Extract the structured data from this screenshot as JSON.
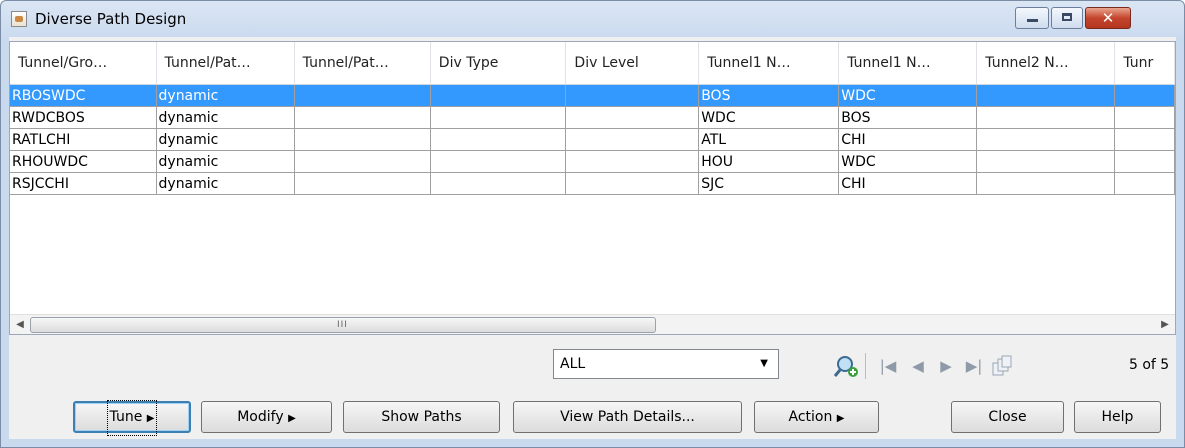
{
  "window": {
    "title": "Diverse Path Design"
  },
  "table": {
    "columns": [
      "Tunnel/Gro…",
      "Tunnel/Pat…",
      "Tunnel/Pat…",
      "Div Type",
      "Div Level",
      "Tunnel1 N…",
      "Tunnel1 N…",
      "Tunnel2 N…",
      "Tunr"
    ],
    "rows": [
      [
        "RBOSWDC",
        "dynamic",
        "",
        "",
        "",
        "BOS",
        "WDC",
        "",
        ""
      ],
      [
        "RWDCBOS",
        "dynamic",
        "",
        "",
        "",
        "WDC",
        "BOS",
        "",
        ""
      ],
      [
        "RATLCHI",
        "dynamic",
        "",
        "",
        "",
        "ATL",
        "CHI",
        "",
        ""
      ],
      [
        "RHOUWDC",
        "dynamic",
        "",
        "",
        "",
        "HOU",
        "WDC",
        "",
        ""
      ],
      [
        "RSJCCHI",
        "dynamic",
        "",
        "",
        "",
        "SJC",
        "CHI",
        "",
        ""
      ]
    ],
    "selected_row": 0,
    "selection_color": "#3399ff",
    "scroll_grip": "III"
  },
  "filter": {
    "value": "ALL"
  },
  "pagination": {
    "count": "5 of 5"
  },
  "buttons": {
    "tune": "Tune",
    "modify": "Modify",
    "show_paths": "Show Paths",
    "view_path_details": "View Path Details...",
    "action": "Action",
    "close": "Close",
    "help": "Help"
  },
  "icons": {
    "arrow_right": "▶",
    "arrow_left": "◀",
    "first": "|◀",
    "prev": "◀",
    "next": "▶",
    "last": "▶|",
    "close_window": "✕"
  }
}
